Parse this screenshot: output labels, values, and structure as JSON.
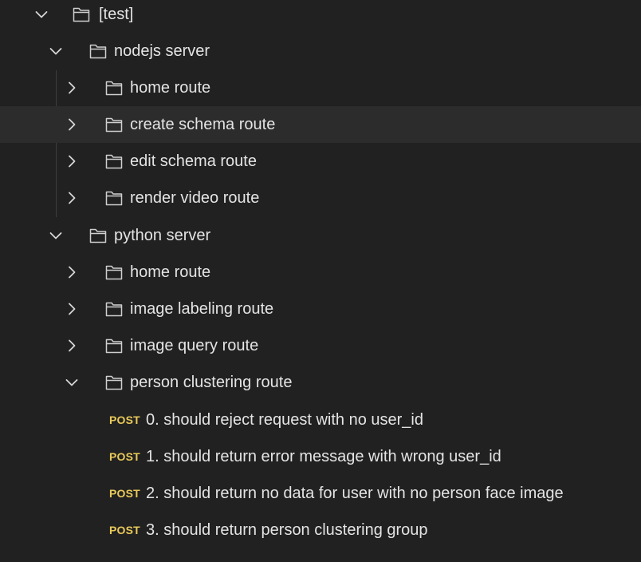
{
  "tree": {
    "root": {
      "label": "[test]",
      "expanded": true,
      "icon": "folder-icon"
    },
    "nodejs": {
      "label": "nodejs server",
      "expanded": true,
      "children": [
        {
          "label": "home route",
          "expanded": false
        },
        {
          "label": "create schema route",
          "expanded": false,
          "hovered": true
        },
        {
          "label": "edit schema route",
          "expanded": false
        },
        {
          "label": "render video route",
          "expanded": false
        }
      ]
    },
    "python": {
      "label": "python server",
      "expanded": true,
      "children": [
        {
          "label": "home route",
          "expanded": false
        },
        {
          "label": "image labeling route",
          "expanded": false
        },
        {
          "label": "image query route",
          "expanded": false
        },
        {
          "label": "person clustering route",
          "expanded": true
        }
      ]
    },
    "requests": [
      {
        "method": "POST",
        "label": "0. should reject request with no user_id"
      },
      {
        "method": "POST",
        "label": "1. should return error message with wrong user_id"
      },
      {
        "method": "POST",
        "label": "2. should return no data for user with no person face image"
      },
      {
        "method": "POST",
        "label": "3. should return person clustering group"
      }
    ]
  },
  "colors": {
    "background": "#212121",
    "hover": "#2c2c2c",
    "text": "#e4e4e4",
    "method_post": "#e8c95a",
    "icon": "#cfcfcf"
  }
}
